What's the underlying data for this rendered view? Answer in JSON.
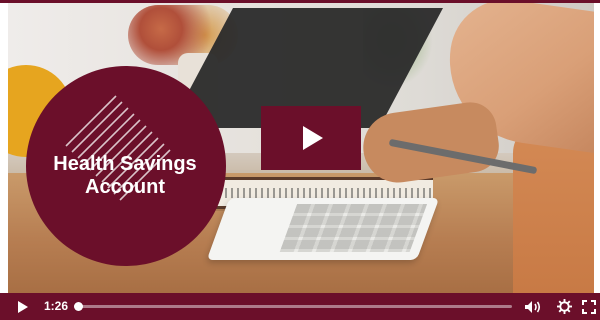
{
  "video": {
    "title_lines": [
      "Health Savings",
      "Account"
    ],
    "time_display": "1:26",
    "progress_fraction": 0.0
  },
  "controls": {
    "play_icon": "play-icon",
    "volume_icon": "volume-icon",
    "settings_icon": "gear-icon",
    "fullscreen_icon": "fullscreen-icon"
  },
  "colors": {
    "brand": "#6b0f2a",
    "accent": "#e6a51f"
  }
}
